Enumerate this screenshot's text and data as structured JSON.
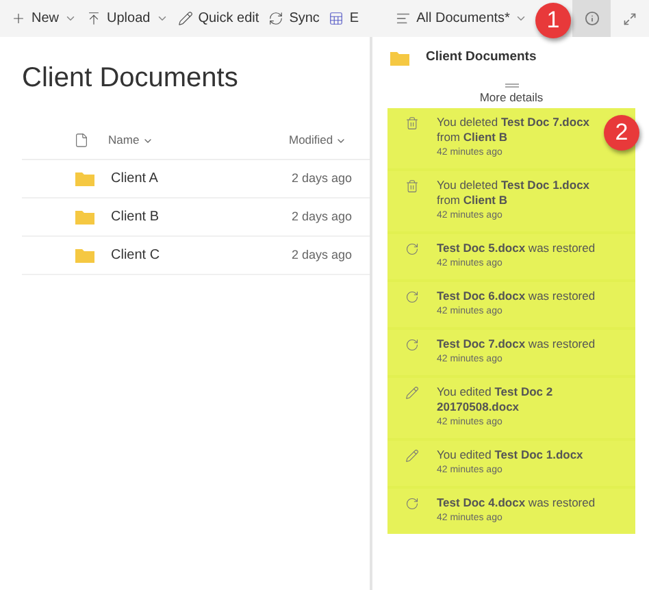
{
  "toolbar": {
    "items": [
      {
        "kind": "new",
        "label": "New",
        "caret": true
      },
      {
        "kind": "upload",
        "label": "Upload",
        "caret": true
      },
      {
        "kind": "edit",
        "label": "Quick edit",
        "caret": false
      },
      {
        "kind": "sync",
        "label": "Sync",
        "caret": false
      },
      {
        "kind": "excel",
        "label": "E",
        "caret": false
      }
    ],
    "view": {
      "label": "All Documents*"
    },
    "info_selected": true
  },
  "library": {
    "title": "Client Documents",
    "columns": [
      "Name",
      "Modified"
    ],
    "rows": [
      {
        "name": "Client A",
        "modified": "2 days ago"
      },
      {
        "name": "Client B",
        "modified": "2 days ago"
      },
      {
        "name": "Client C",
        "modified": "2 days ago"
      }
    ]
  },
  "details": {
    "title": "Client Documents",
    "more": "More details",
    "activity": [
      {
        "kind": "delete",
        "text": "You deleted **Test Doc 7.docx** from **Client B**",
        "time": "42 minutes ago"
      },
      {
        "kind": "delete",
        "text": "You deleted **Test Doc 1.docx** from **Client B**",
        "time": "42 minutes ago"
      },
      {
        "kind": "restore",
        "text": "**Test Doc 5.docx** was restored",
        "time": "42 minutes ago"
      },
      {
        "kind": "restore",
        "text": "**Test Doc 6.docx** was restored",
        "time": "42 minutes ago"
      },
      {
        "kind": "restore",
        "text": "**Test Doc 7.docx** was restored",
        "time": "42 minutes ago"
      },
      {
        "kind": "edit",
        "text": "You edited **Test Doc 2 20170508.docx**",
        "time": "42 minutes ago"
      },
      {
        "kind": "edit",
        "text": "You edited **Test Doc 1.docx**",
        "time": "42 minutes ago"
      },
      {
        "kind": "restore",
        "text": "**Test Doc 4.docx** was restored",
        "time": "42 minutes ago"
      }
    ]
  },
  "callouts": [
    "1",
    "2"
  ]
}
